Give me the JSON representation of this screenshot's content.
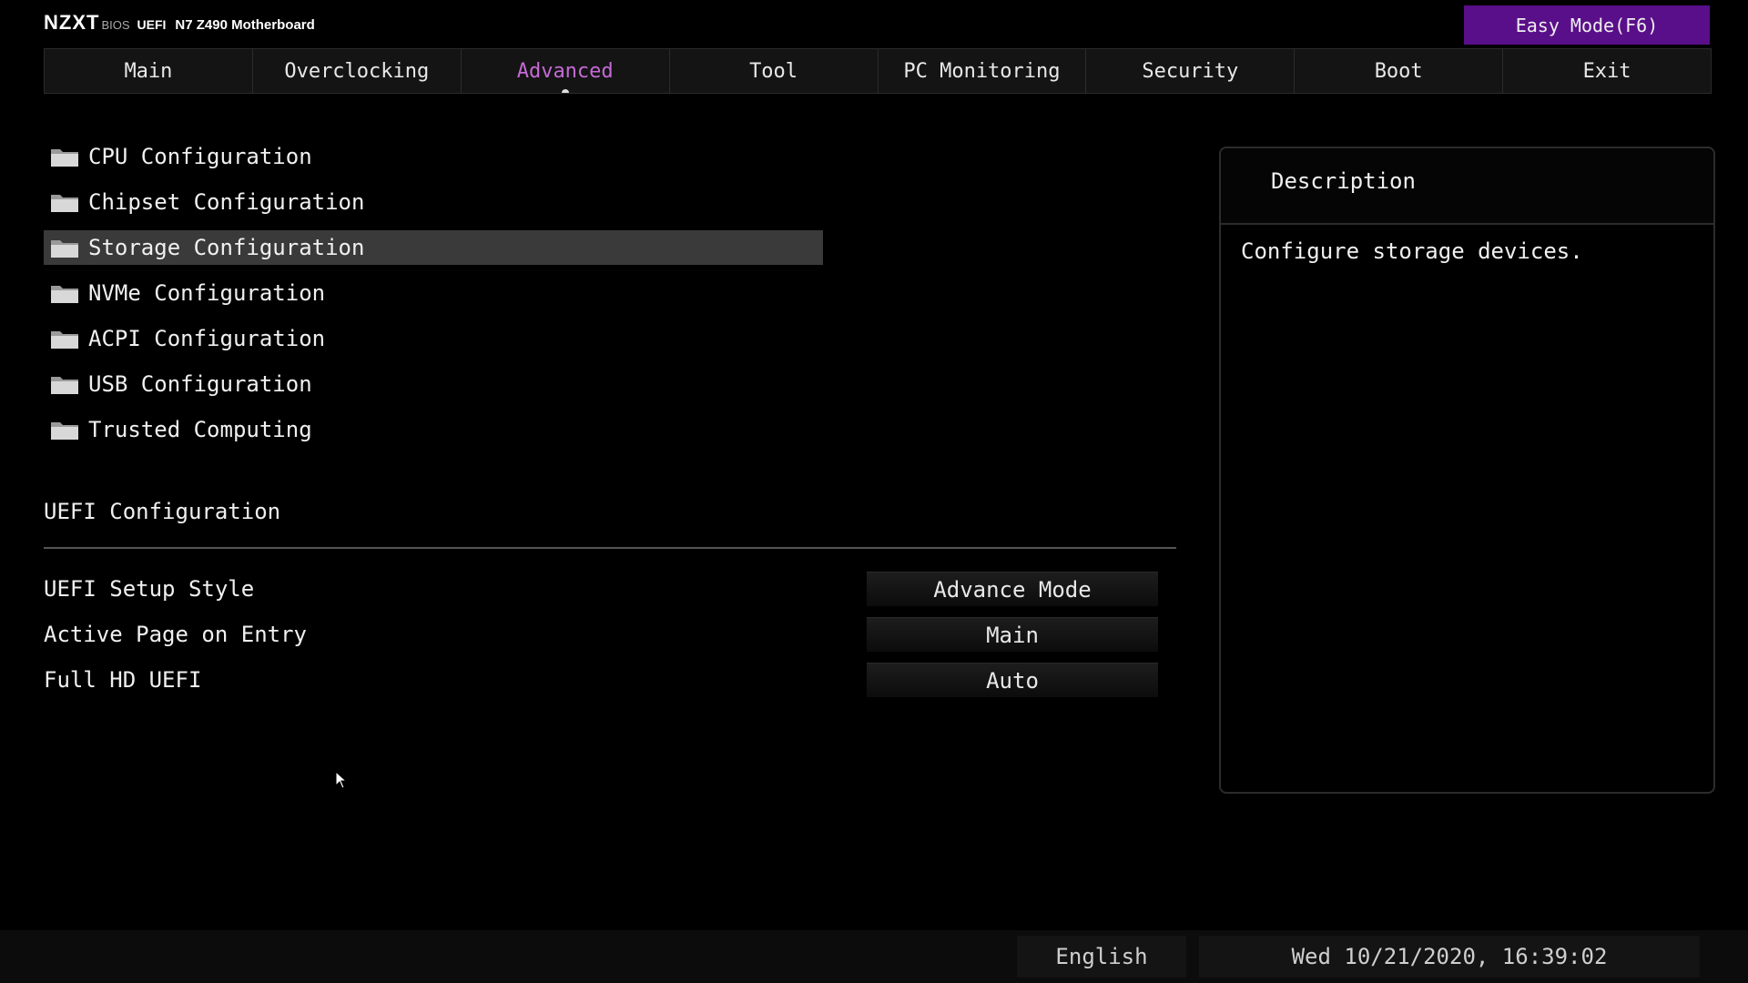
{
  "header": {
    "brand_logo": "NZXT",
    "brand_bios": "BIOS",
    "brand_uefi": "UEFI",
    "model": "N7 Z490 Motherboard",
    "easy_mode_label": "Easy Mode(F6)"
  },
  "tabs": [
    {
      "label": "Main"
    },
    {
      "label": "Overclocking"
    },
    {
      "label": "Advanced",
      "active": true
    },
    {
      "label": "Tool"
    },
    {
      "label": "PC Monitoring"
    },
    {
      "label": "Security"
    },
    {
      "label": "Boot"
    },
    {
      "label": "Exit"
    }
  ],
  "menu": {
    "items": [
      {
        "label": "CPU Configuration"
      },
      {
        "label": "Chipset Configuration"
      },
      {
        "label": "Storage Configuration",
        "selected": true
      },
      {
        "label": "NVMe Configuration"
      },
      {
        "label": "ACPI Configuration"
      },
      {
        "label": "USB Configuration"
      },
      {
        "label": "Trusted Computing"
      }
    ]
  },
  "uefi_config": {
    "title": "UEFI Configuration",
    "settings": [
      {
        "label": "UEFI Setup Style",
        "value": "Advance Mode"
      },
      {
        "label": "Active Page on Entry",
        "value": "Main"
      },
      {
        "label": "Full HD UEFI",
        "value": "Auto"
      }
    ]
  },
  "description": {
    "title": "Description",
    "text": "Configure storage devices."
  },
  "footer": {
    "language": "English",
    "datetime": "Wed 10/21/2020, 16:39:02"
  },
  "colors": {
    "accent": "#c56ad6",
    "easy_mode_bg": "#5a0f8a",
    "selected_bg": "#3a3a3a"
  },
  "icons": {
    "menu_item": "folder-icon",
    "cursor": "mouse-pointer-icon"
  }
}
